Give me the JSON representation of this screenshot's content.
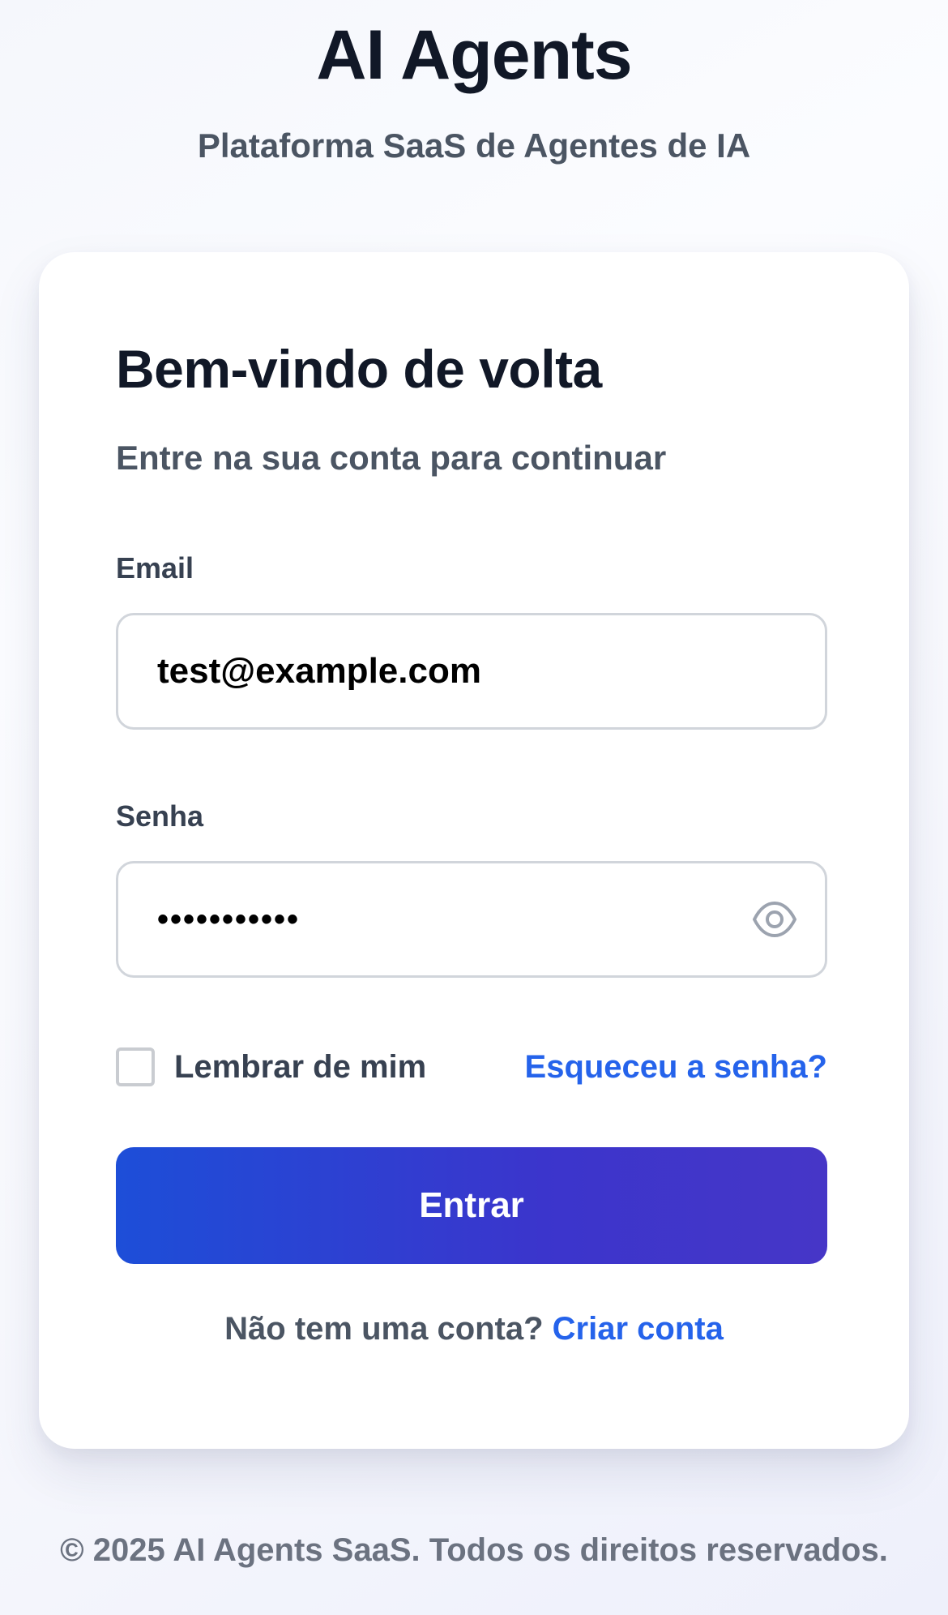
{
  "brand": {
    "title": "AI Agents",
    "subtitle": "Plataforma SaaS de Agentes de IA"
  },
  "login": {
    "title": "Bem-vindo de volta",
    "subtitle": "Entre na sua conta para continuar",
    "email": {
      "label": "Email",
      "value": "test@example.com"
    },
    "password": {
      "label": "Senha",
      "masked_value": "•••••••••••",
      "toggle_icon": "eye-icon"
    },
    "remember_me": {
      "label": "Lembrar de mim",
      "checked": false
    },
    "forgot_password": "Esqueceu a senha?",
    "submit_label": "Entrar",
    "signup_prompt": "Não tem uma conta?",
    "signup_link": "Criar conta"
  },
  "footer": {
    "text": "© 2025 AI Agents SaaS. Todos os direitos reservados."
  },
  "colors": {
    "primary": "#2563eb",
    "button_gradient_start": "#1d4ed8",
    "button_gradient_end": "#4636c7",
    "heading": "#111827",
    "muted": "#4b5563"
  }
}
